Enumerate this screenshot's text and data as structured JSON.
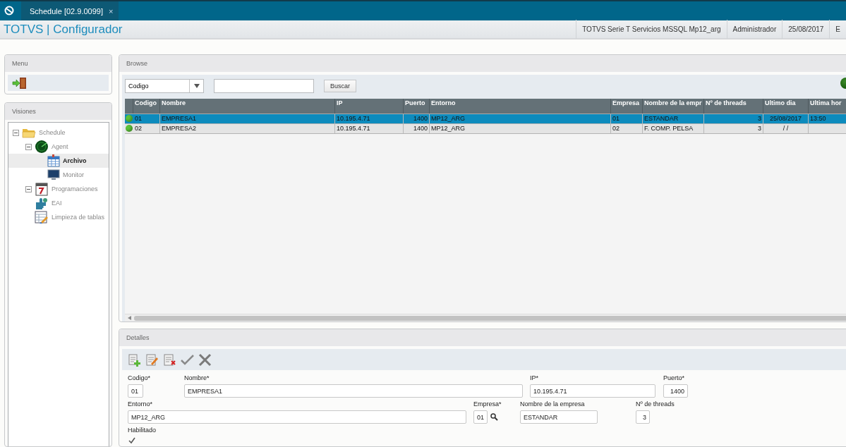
{
  "app_tab": {
    "label": "Schedule [02.9.0099]",
    "close": "×",
    "selected": true
  },
  "header": {
    "title": "TOTVS | Configurador",
    "info": [
      "TOTVS Serie T Servicios MSSQL Mp12_arg",
      "Administrador",
      "25/08/2017",
      "E"
    ]
  },
  "menu": {
    "title": "Menu"
  },
  "visiones": {
    "title": "Visiones",
    "tree": [
      {
        "label": "Schedule",
        "kind": "folder",
        "expanded": true,
        "selected": false,
        "children": [
          {
            "label": "Agent",
            "kind": "radar",
            "expanded": true,
            "selected": false,
            "children": [
              {
                "label": "Archivo",
                "kind": "table",
                "selected": true
              },
              {
                "label": "Monitor",
                "kind": "monitor",
                "selected": false
              }
            ]
          },
          {
            "label": "Programaciones",
            "kind": "calendar",
            "expanded": true,
            "selected": false
          },
          {
            "label": "EAI",
            "kind": "puzzle",
            "selected": false
          },
          {
            "label": "Limpieza de tablas",
            "kind": "sheet",
            "selected": false
          }
        ]
      }
    ]
  },
  "browse": {
    "title": "Browse",
    "search_by": "Codigo",
    "search_button": "Buscar",
    "table": {
      "columns": [
        "Codigo",
        "Nombre",
        "IP",
        "Puerto",
        "Entorno",
        "Empresa",
        "Nombre de la empr",
        "Nº de threads",
        "Ultimo dia",
        "Ultima hor"
      ],
      "rows": [
        {
          "selected": true,
          "color": "#5cc23a",
          "cells": [
            "01",
            "EMPRESA1",
            "10.195.4.71",
            "1400",
            "MP12_ARG",
            "01",
            "ESTANDAR",
            "3",
            "25/08/2017",
            "13:50"
          ]
        },
        {
          "selected": false,
          "color": "#5cc23a",
          "cells": [
            "02",
            "EMPRESA2",
            "10.195.4.71",
            "1400",
            "MP12_ARG",
            "02",
            "F. COMP. PELSA",
            "3",
            " / /",
            ""
          ]
        }
      ]
    }
  },
  "detalles": {
    "title": "Detalles",
    "fields": [
      {
        "label": "Codigo*",
        "value": "01"
      },
      {
        "label": "Nombre*",
        "value": "EMPRESA1"
      },
      {
        "label": "IP*",
        "value": "10.195.4.71"
      },
      {
        "label": "Puerto*",
        "value": "1400"
      },
      {
        "label": "Entorno*",
        "value": "MP12_ARG"
      },
      {
        "label": "Empresa*",
        "value": "01"
      },
      {
        "label": "Nombre de la empresa",
        "value": "ESTANDAR"
      },
      {
        "label": "Nº de threads",
        "value": "3"
      }
    ],
    "habilitado": {
      "label": "Habilitado",
      "checked": true
    }
  }
}
